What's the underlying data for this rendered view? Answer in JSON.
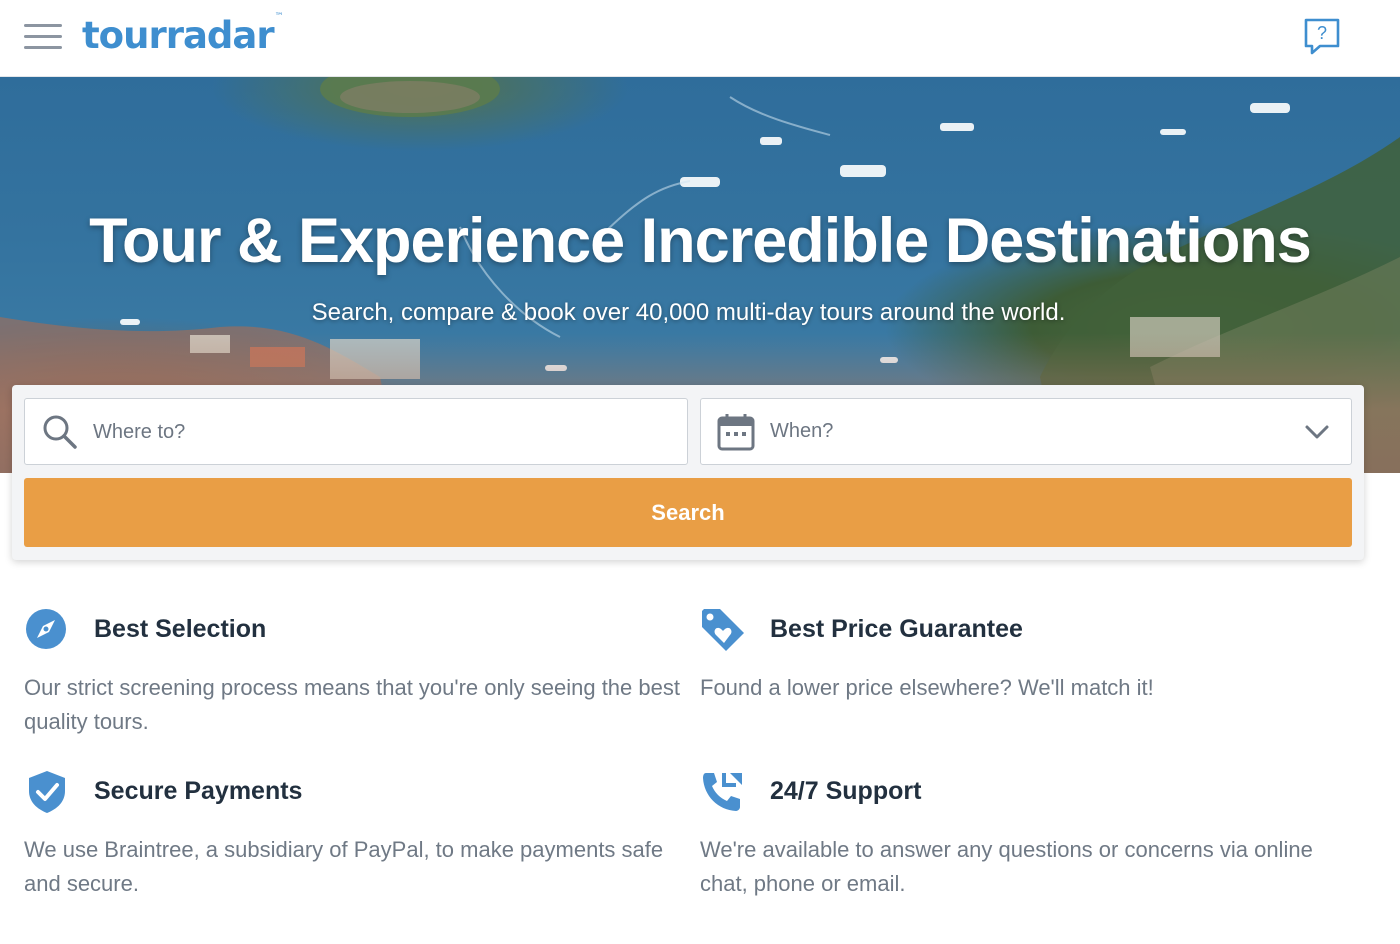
{
  "header": {
    "logo_text": "tourradar",
    "logo_trademark": "™",
    "menu_icon": "hamburger-menu-icon",
    "help_icon": "help-chat-icon",
    "brand_color": "#3e8ecf"
  },
  "hero": {
    "title": "Tour & Experience Incredible Destinations",
    "subtitle": "Search, compare & book over 40,000 multi-day tours around the world."
  },
  "search": {
    "where_placeholder": "Where to?",
    "when_value": "When?",
    "button_label": "Search",
    "button_color": "#e99e45",
    "where_icon": "search-icon",
    "when_icon": "calendar-icon",
    "dropdown_icon": "chevron-down-icon"
  },
  "features": [
    {
      "icon": "compass-icon",
      "title": "Best Selection",
      "description": "Our strict screening process means that you're only seeing the best quality tours."
    },
    {
      "icon": "price-tag-heart-icon",
      "title": "Best Price Guarantee",
      "description": "Found a lower price elsewhere? We'll match it!"
    },
    {
      "icon": "shield-check-icon",
      "title": "Secure Payments",
      "description": "We use Braintree, a subsidiary of PayPal, to make payments safe and secure."
    },
    {
      "icon": "phone-support-icon",
      "title": "24/7 Support",
      "description": "We're available to answer any questions or concerns via online chat, phone or email."
    }
  ],
  "colors": {
    "icon_blue": "#4a90cf",
    "heading_text": "#22303f",
    "body_text": "#6f7985"
  }
}
